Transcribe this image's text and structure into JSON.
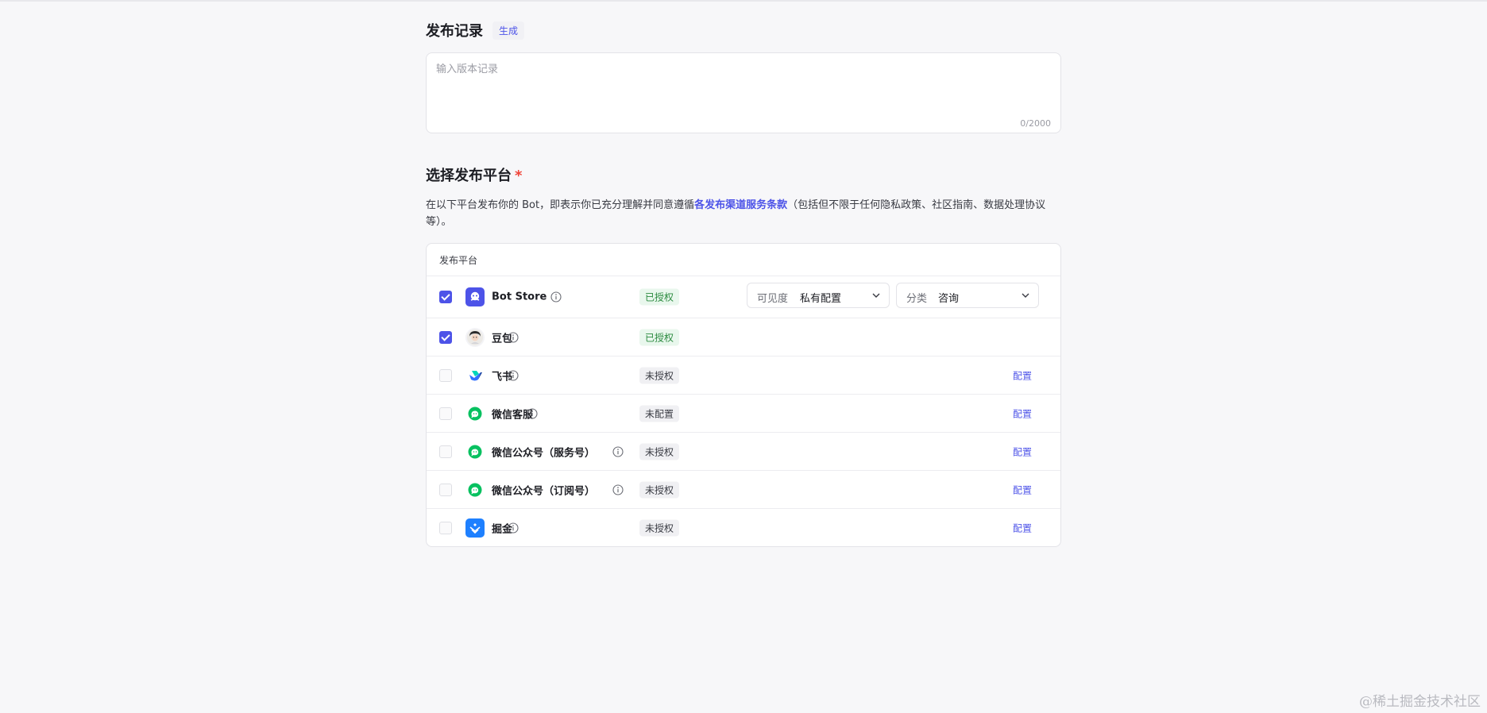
{
  "release_notes": {
    "title": "发布记录",
    "generate_label": "生成",
    "placeholder": "输入版本记录",
    "counter": "0/2000"
  },
  "platform_section": {
    "title": "选择发布平台",
    "required_mark": "*",
    "desc_before": "在以下平台发布你的 Bot，即表示你已充分理解并同意遵循",
    "desc_link": "各发布渠道服务条款",
    "desc_after": "（包括但不限于任何隐私政策、社区指南、数据处理协议等）。",
    "table_header": "发布平台"
  },
  "platforms": [
    {
      "name": "Bot Store",
      "checked": true,
      "status": "已授权",
      "status_type": "ok",
      "icon": "bot-store-icon"
    },
    {
      "name": "豆包",
      "checked": true,
      "status": "已授权",
      "status_type": "ok",
      "icon": "doubao-avatar-icon"
    },
    {
      "name": "飞书",
      "checked": false,
      "status": "未授权",
      "status_type": "no",
      "action": "配置",
      "icon": "feishu-icon"
    },
    {
      "name": "微信客服",
      "checked": false,
      "status": "未配置",
      "status_type": "no",
      "action": "配置",
      "icon": "wechat-icon"
    },
    {
      "name": "微信公众号（服务号）",
      "checked": false,
      "status": "未授权",
      "status_type": "no",
      "action": "配置",
      "icon": "wechat-icon"
    },
    {
      "name": "微信公众号（订阅号）",
      "checked": false,
      "status": "未授权",
      "status_type": "no",
      "action": "配置",
      "icon": "wechat-icon"
    },
    {
      "name": "掘金",
      "checked": false,
      "status": "未授权",
      "status_type": "no",
      "action": "配置",
      "icon": "juejin-icon"
    }
  ],
  "bot_store_options": {
    "visibility_label": "可见度",
    "visibility_value": "私有配置",
    "category_label": "分类",
    "category_value": "咨询"
  },
  "colors": {
    "accent": "#4d53e8",
    "auth_badge_bg": "#e9f7ed",
    "auth_badge_text": "#2a8a3e",
    "wechat_green": "#07c160",
    "juejin_blue": "#1e80ff"
  },
  "watermark": "@稀土掘金技术社区"
}
